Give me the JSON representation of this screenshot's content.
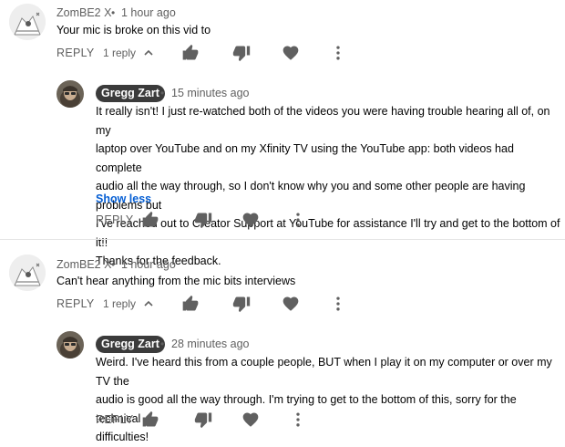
{
  "comments": [
    {
      "author": "ZomBE2 X",
      "time": "1 hour ago",
      "text": "Your mic is broke on this vid to",
      "reply_label": "REPLY",
      "reply_count": "1 reply",
      "reply": {
        "author": "Gregg Zart",
        "time": "15 minutes ago",
        "lines": [
          "It really isn't! I just re-watched both of the videos you were having trouble hearing all of, on my",
          "laptop over YouTube and on my Xfinity TV using the YouTube app: both videos had complete",
          "audio all the way through, so I don't know why you and some other people are having problems but",
          "I've reached out to Creator Support at YouTube for assistance I'll try and get to the bottom of it!!",
          "Thanks for the feedback."
        ],
        "show_less": "Show less",
        "reply_label": "REPLY"
      }
    },
    {
      "author": "ZomBE2 X",
      "time": "1 hour ago",
      "text": "Can't hear anything from the mic bits interviews",
      "reply_label": "REPLY",
      "reply_count": "1 reply",
      "reply": {
        "author": "Gregg Zart",
        "time": "28 minutes ago",
        "lines": [
          "Weird. I've heard this from a couple people, BUT when I play it on my computer or over my TV the",
          "audio is good all the way through. I'm trying to get to the bottom of this, sorry for the technical",
          "difficulties!"
        ],
        "reply_label": "REPLY"
      }
    }
  ],
  "separator": "•",
  "icons": {
    "like": "thumbs-up-icon",
    "dislike": "thumbs-down-icon",
    "heart": "heart-icon",
    "more": "more-vert-icon",
    "chevron": "chevron-up-icon"
  },
  "colors": {
    "icon": "#606060",
    "link": "#065fd4",
    "chip": "#3b3b3b"
  }
}
